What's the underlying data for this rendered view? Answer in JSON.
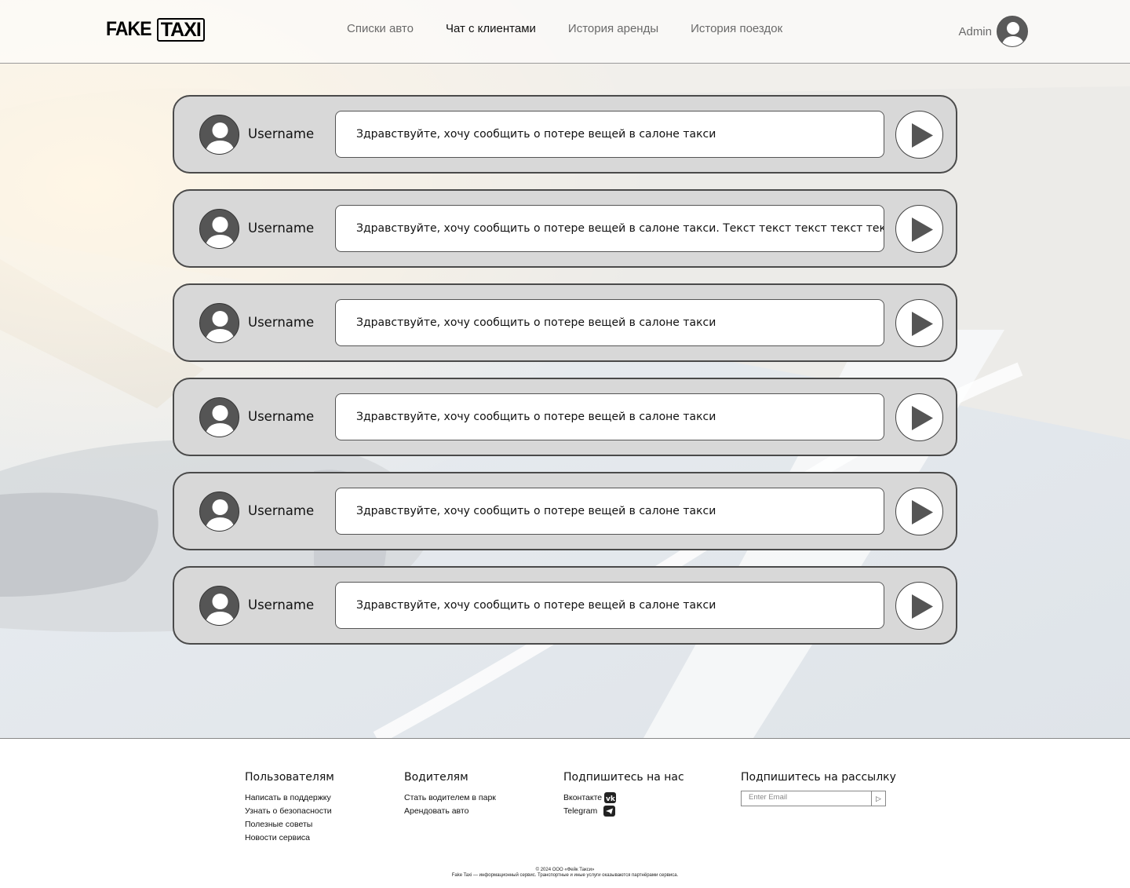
{
  "header": {
    "logo_part1": "FAKE",
    "logo_part2": "TAXI",
    "nav": [
      {
        "label": "Списки авто",
        "active": false
      },
      {
        "label": "Чат с клиентами",
        "active": true
      },
      {
        "label": "История аренды",
        "active": false
      },
      {
        "label": "История поездок",
        "active": false
      }
    ],
    "user_name": "Admin"
  },
  "chats": [
    {
      "username": "Username",
      "message": "Здравствуйте, хочу сообщить о потере вещей в салоне такси"
    },
    {
      "username": "Username",
      "message": "Здравствуйте, хочу сообщить о потере вещей в салоне такси. Текст текст текст текст текст текст"
    },
    {
      "username": "Username",
      "message": "Здравствуйте, хочу сообщить о потере вещей в салоне такси"
    },
    {
      "username": "Username",
      "message": "Здравствуйте, хочу сообщить о потере вещей в салоне такси"
    },
    {
      "username": "Username",
      "message": "Здравствуйте, хочу сообщить о потере вещей в салоне такси"
    },
    {
      "username": "Username",
      "message": "Здравствуйте, хочу сообщить о потере вещей в салоне такси"
    }
  ],
  "footer": {
    "users": {
      "title": "Пользователям",
      "links": [
        "Написать в поддержку",
        "Узнать о безопасности",
        "Полезные советы",
        "Новости сервиса"
      ]
    },
    "drivers": {
      "title": "Водителям",
      "links": [
        "Стать водителем в парк",
        "Арендовать авто"
      ]
    },
    "social": {
      "title": "Подпишитесь на нас",
      "links": [
        {
          "label": "Вконтакте",
          "icon": "vk-icon"
        },
        {
          "label": "Telegram",
          "icon": "telegram-icon"
        }
      ]
    },
    "newsletter": {
      "title": "Подпишитесь на рассылку",
      "placeholder": "Enter Email",
      "button": "▷"
    },
    "copyright": "© 2024 ООО «Фейк Такси»",
    "disclaimer": "Fake Taxi — информационный сервис. Транспортные и иные услуги оказываются партнёрами сервиса."
  }
}
